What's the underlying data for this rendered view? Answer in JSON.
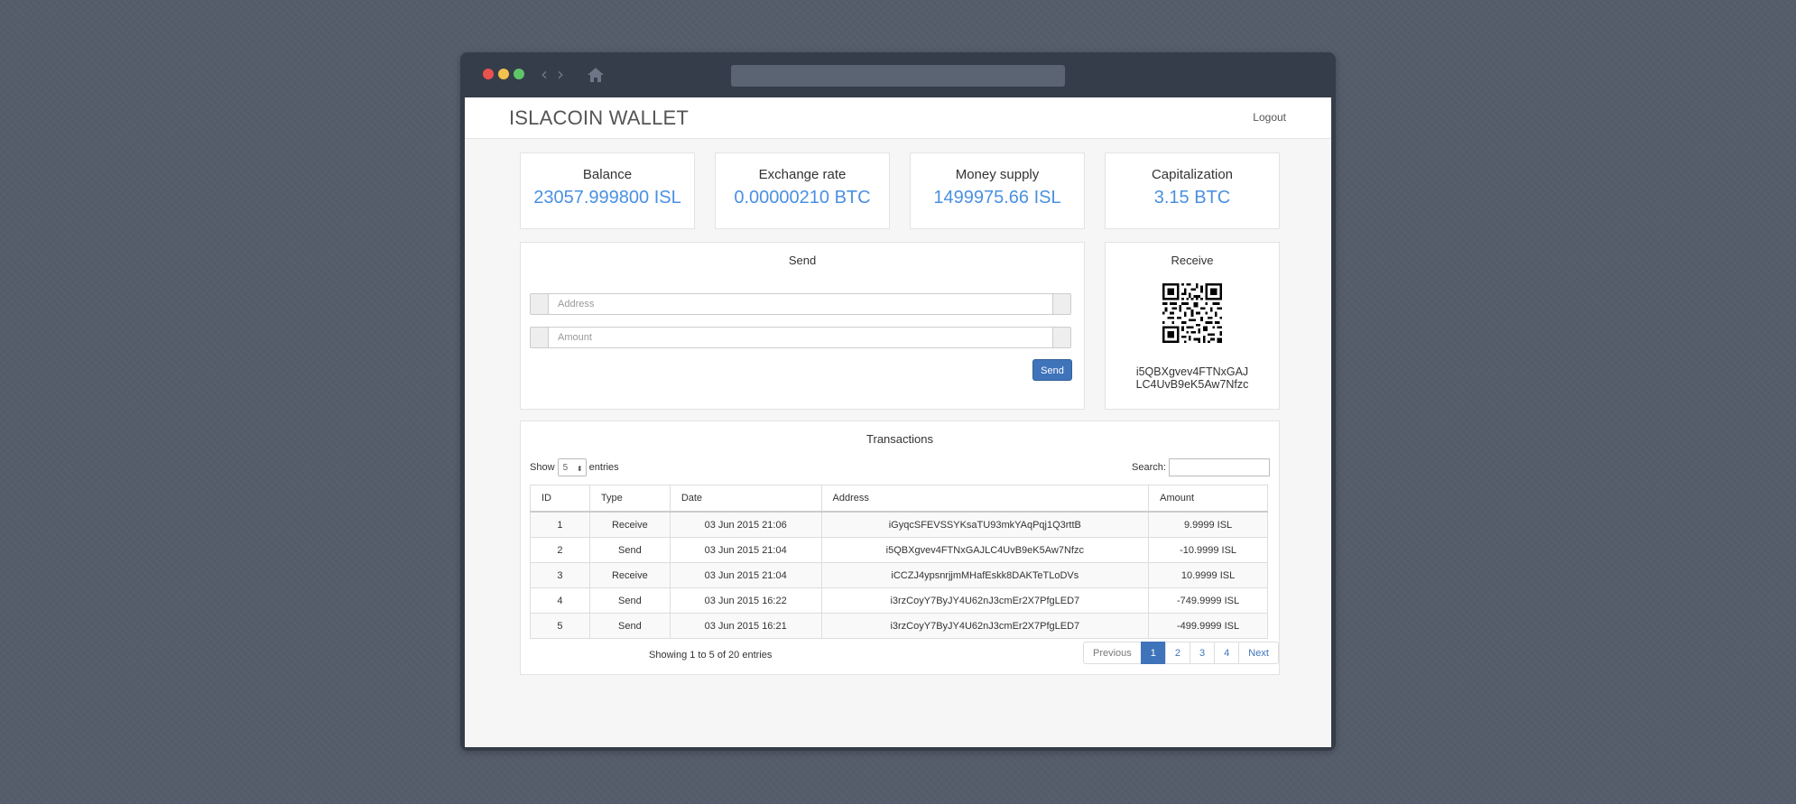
{
  "browser": {
    "icons": {
      "back": "chevron-left-icon",
      "forward": "chevron-right-icon",
      "home": "home-icon"
    }
  },
  "app": {
    "brand": "ISLACOIN WALLET",
    "logout": "Logout"
  },
  "stats": [
    {
      "title": "Balance",
      "value": "23057.999800 ISL"
    },
    {
      "title": "Exchange rate",
      "value": "0.00000210 BTC"
    },
    {
      "title": "Money supply",
      "value": "1499975.66 ISL"
    },
    {
      "title": "Capitalization",
      "value": "3.15 BTC"
    }
  ],
  "send": {
    "title": "Send",
    "address_placeholder": "Address",
    "amount_placeholder": "Amount",
    "button": "Send"
  },
  "receive": {
    "title": "Receive",
    "address_line1": "i5QBXgvev4FTNxGAJ",
    "address_line2": "LC4UvB9eK5Aw7Nfzc"
  },
  "transactions": {
    "title": "Transactions",
    "show_label": "Show",
    "show_value": "5",
    "entries_label": "entries",
    "search_label": "Search:",
    "columns": [
      "ID",
      "Type",
      "Date",
      "Address",
      "Amount"
    ],
    "rows": [
      {
        "id": "1",
        "type": "Receive",
        "date": "03 Jun 2015 21:06",
        "address": "iGyqcSFEVSSYKsaTU93mkYAqPqj1Q3rttB",
        "amount": "9.9999 ISL"
      },
      {
        "id": "2",
        "type": "Send",
        "date": "03 Jun 2015 21:04",
        "address": "i5QBXgvev4FTNxGAJLC4UvB9eK5Aw7Nfzc",
        "amount": "-10.9999 ISL"
      },
      {
        "id": "3",
        "type": "Receive",
        "date": "03 Jun 2015 21:04",
        "address": "iCCZJ4ypsnrjjmMHafEskk8DAKTeTLoDVs",
        "amount": "10.9999 ISL"
      },
      {
        "id": "4",
        "type": "Send",
        "date": "03 Jun 2015 16:22",
        "address": "i3rzCoyY7ByJY4U62nJ3cmEr2X7PfgLED7",
        "amount": "-749.9999 ISL"
      },
      {
        "id": "5",
        "type": "Send",
        "date": "03 Jun 2015 16:21",
        "address": "i3rzCoyY7ByJY4U62nJ3cmEr2X7PfgLED7",
        "amount": "-499.9999 ISL"
      }
    ],
    "info": "Showing 1 to 5 of 20 entries",
    "pagination": {
      "previous": "Previous",
      "pages": [
        "1",
        "2",
        "3",
        "4"
      ],
      "active": "1",
      "next": "Next"
    }
  },
  "colors": {
    "accent": "#4a90e2",
    "primary_button": "#3f74bb",
    "background": "#555d6b",
    "window_chrome": "#353d4a"
  }
}
